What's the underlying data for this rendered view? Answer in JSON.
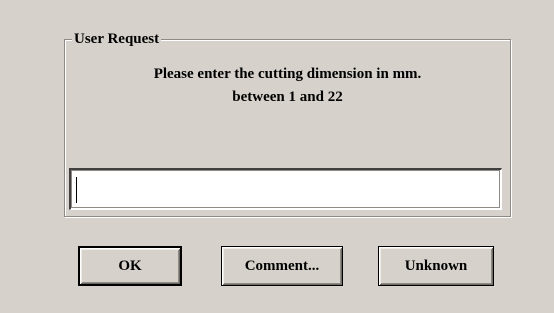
{
  "dialog": {
    "group_title": "User Request",
    "prompt_line1": "Please enter the cutting dimension in mm.",
    "prompt_line2": "between 1 and 22",
    "input": {
      "value": "",
      "placeholder": ""
    },
    "buttons": {
      "ok_label": "OK",
      "comment_label": "Comment...",
      "unknown_label": "Unknown"
    }
  },
  "colors": {
    "dialog_background": "#d6d2cb",
    "input_background": "#ffffff",
    "text": "#000000"
  }
}
